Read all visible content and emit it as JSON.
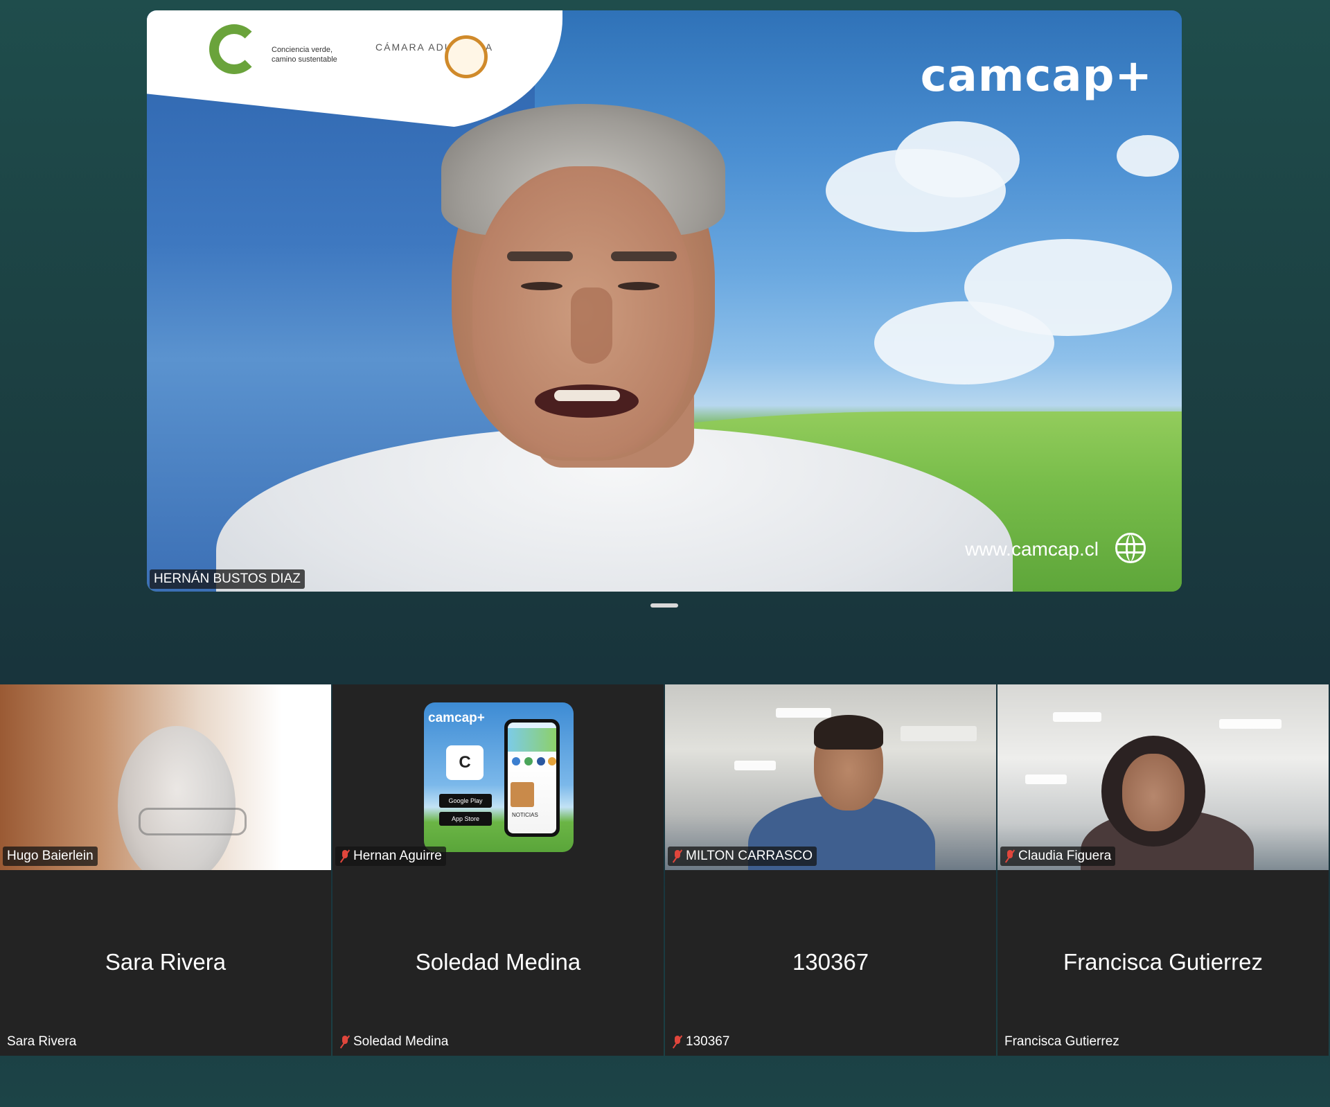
{
  "speaker": {
    "name": "HERNÁN BUSTOS DIAZ",
    "brand": "camcap+",
    "url": "www.camcap.cl",
    "logo_left_text": "Conciencia verde, camino sustentable",
    "logo_right_text": "CÁMARA ADUANERA"
  },
  "gallery": {
    "video_tiles": [
      {
        "name": "Hugo Baierlein",
        "muted": false
      },
      {
        "name": "Hernan Aguirre",
        "muted": true
      },
      {
        "name": "MILTON CARRASCO",
        "muted": true
      },
      {
        "name": "Claudia Figuera",
        "muted": true
      }
    ],
    "name_tiles": [
      {
        "display": "Sara Rivera",
        "name": "Sara Rivera",
        "muted": false
      },
      {
        "display": "Soledad Medina",
        "name": "Soledad Medina",
        "muted": true
      },
      {
        "display": "130367",
        "name": "130367",
        "muted": true
      },
      {
        "display": "Francisca Gutierrez",
        "name": "Francisca Gutierrez",
        "muted": false
      }
    ]
  },
  "app_card": {
    "brand": "camcap+",
    "badge_google": "Google Play",
    "badge_apple": "App Store",
    "noticias": "NOTICIAS",
    "phone_brand": "camcap"
  },
  "icons": {
    "mic": "mic-off-icon",
    "globe": "globe-icon"
  },
  "colors": {
    "mic_off": "#e0463c",
    "tile_bg": "#232323",
    "background": "#1b3d40"
  }
}
